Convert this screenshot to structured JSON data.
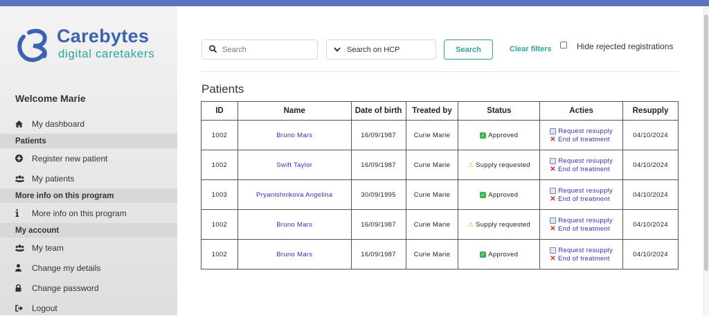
{
  "brand": {
    "name": "Carebytes",
    "tagline": "digital caretakers",
    "primary_color": "#3a63b6",
    "accent_color": "#2aa89c",
    "topbar_color": "#5b73c3"
  },
  "sidebar": {
    "welcome": "Welcome Marie",
    "dashboard": {
      "label": "My dashboard",
      "icon": "home-icon"
    },
    "sections": {
      "patients": "Patients",
      "more_info": "More info on this program",
      "account": "My account"
    },
    "register": {
      "label": "Register new patient",
      "icon": "plus-circle-icon"
    },
    "my_patients": {
      "label": "My patients",
      "icon": "users-icon"
    },
    "program_info": {
      "label": "More info on this program",
      "icon": "info-icon"
    },
    "team": {
      "label": "My team",
      "icon": "users-icon"
    },
    "details": {
      "label": "Change my details",
      "icon": "user-icon"
    },
    "password": {
      "label": "Change password",
      "icon": "lock-icon"
    },
    "logout": {
      "label": "Logout",
      "icon": "logout-icon"
    }
  },
  "toolbar": {
    "search_placeholder": "Search",
    "search_scope": "Search on HCP",
    "search_button": "Search",
    "clear_filters": "Clear filters",
    "hide_rejected": "Hide rejected registrations",
    "hide_rejected_checked": false
  },
  "patients": {
    "title": "Patients",
    "columns": {
      "id": "ID",
      "name": "Name",
      "dob": "Date of birth",
      "treated_by": "Treated by",
      "status": "Status",
      "actions": "Acties",
      "resupply": "Resupply"
    },
    "action_labels": {
      "request": "Request resupply",
      "end": "End of treatment"
    },
    "rows": [
      {
        "id": "1002",
        "name": "Bruno Mars",
        "dob": "16/09/1987",
        "treated_by": "Curie Marie",
        "status": "Approved",
        "status_type": "approved",
        "resupply": "04/10/2024"
      },
      {
        "id": "1002",
        "name": "Swift Taylor",
        "dob": "16/09/1987",
        "treated_by": "Curie Marie",
        "status": "Supply requested",
        "status_type": "warning",
        "resupply": "04/10/2024"
      },
      {
        "id": "1003",
        "name": "Pryanishnikova Angelina",
        "dob": "30/09/1995",
        "treated_by": "Curie Marie",
        "status": "Approved",
        "status_type": "approved",
        "resupply": "04/10/2024"
      },
      {
        "id": "1002",
        "name": "Bruno Mars",
        "dob": "16/09/1987",
        "treated_by": "Curie Marie",
        "status": "Supply requested",
        "status_type": "warning",
        "resupply": "04/10/2024"
      },
      {
        "id": "1002",
        "name": "Bruno Mars",
        "dob": "16/09/1987",
        "treated_by": "Curie Marie",
        "status": "Approved",
        "status_type": "approved",
        "resupply": "04/10/2024"
      }
    ]
  }
}
